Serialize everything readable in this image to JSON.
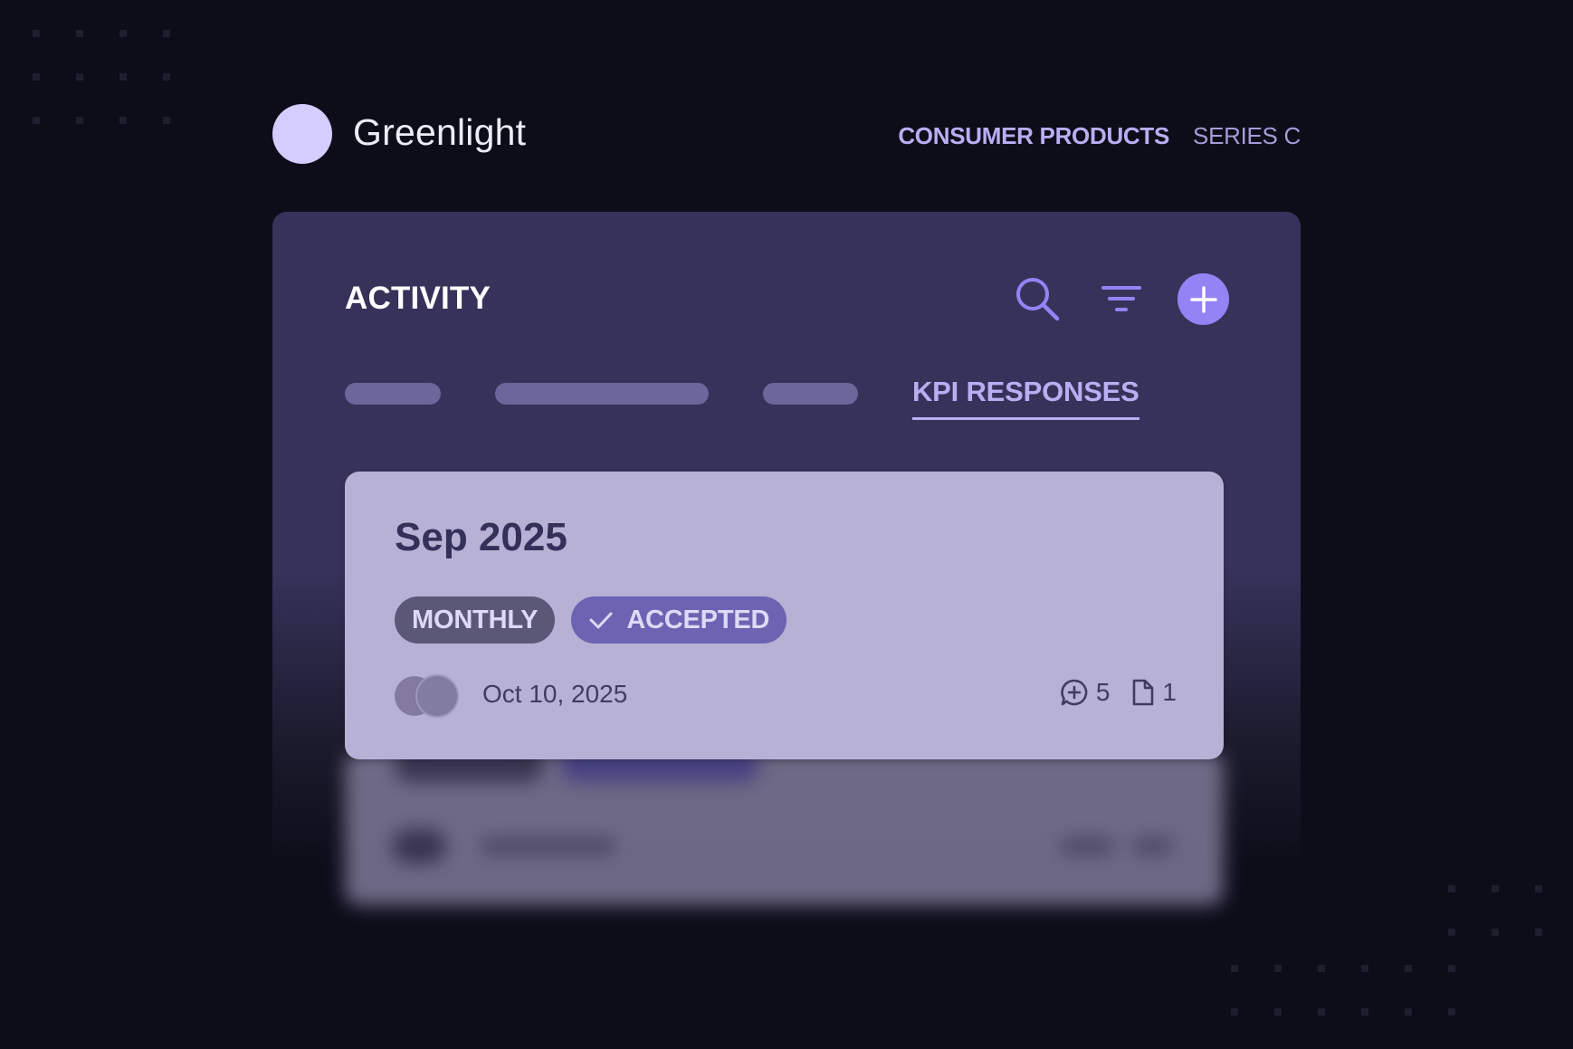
{
  "header": {
    "brand_name": "Greenlight",
    "industry": "CONSUMER PRODUCTS",
    "stage": "SERIES C"
  },
  "panel": {
    "title": "ACTIVITY",
    "actions": [
      "search-icon",
      "filter-icon",
      "plus-icon"
    ],
    "active_tab": "KPI RESPONSES"
  },
  "card": {
    "title": "Sep 2025",
    "frequency_badge": "MONTHLY",
    "status_badge": "ACCEPTED",
    "date": "Oct 10, 2025",
    "comments_count": "5",
    "files_count": "1"
  },
  "colors": {
    "background": "#0d0d1a",
    "panel": "#36325a",
    "accent": "#9483f5",
    "card": "#b7b1d5",
    "logo": "#d5ccff"
  }
}
